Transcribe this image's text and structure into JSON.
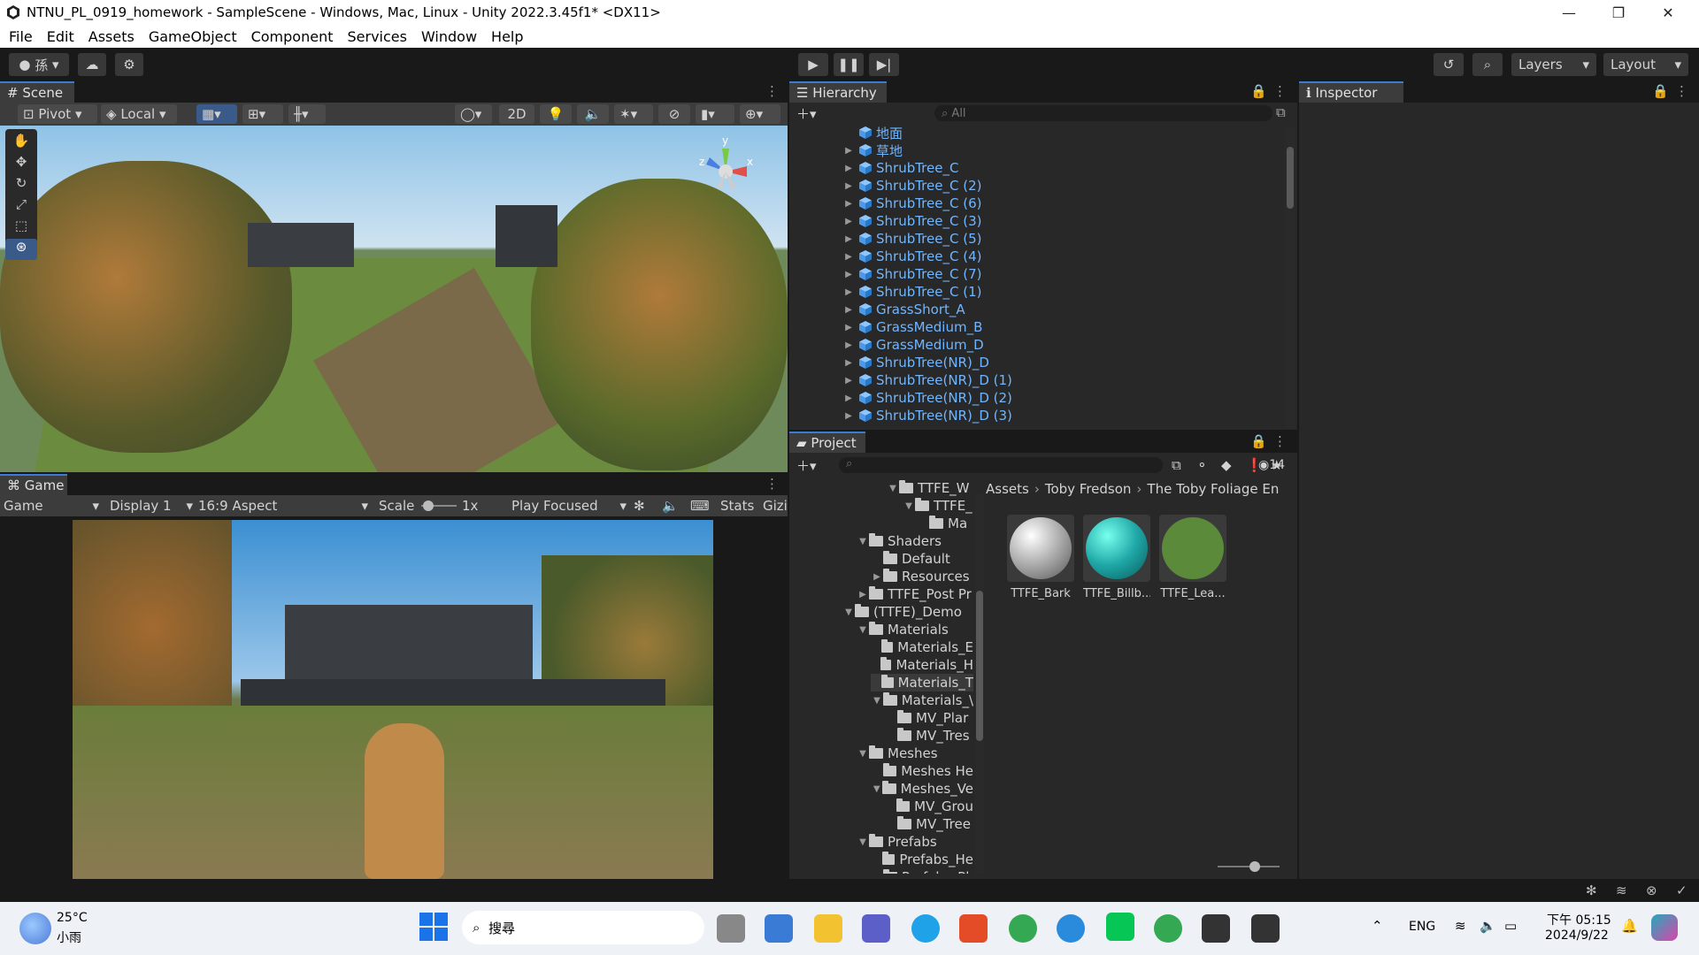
{
  "window": {
    "title": "NTNU_PL_0919_homework - SampleScene - Windows, Mac, Linux - Unity 2022.3.45f1* <DX11>"
  },
  "menu": [
    "File",
    "Edit",
    "Assets",
    "GameObject",
    "Component",
    "Services",
    "Window",
    "Help"
  ],
  "toolbar": {
    "layers": "Layers",
    "layout": "Layout",
    "account_label": "孫"
  },
  "scene": {
    "tab": "Scene",
    "pivot": "Pivot",
    "local": "Local",
    "mode2d": "2D",
    "gizmo_axes": {
      "y": "y",
      "z": "z",
      "x": "x"
    }
  },
  "game": {
    "tab": "Game",
    "view": "Game",
    "display": "Display 1",
    "aspect": "16:9 Aspect",
    "scale_label": "Scale",
    "scale_value": "1x",
    "play_mode": "Play Focused",
    "stats": "Stats",
    "gizmos": "Gizi"
  },
  "hierarchy": {
    "tab": "Hierarchy",
    "search_placeholder": "All",
    "items": [
      {
        "label": "地面",
        "arrow": ""
      },
      {
        "label": "草地",
        "arrow": "▶"
      },
      {
        "label": "ShrubTree_C",
        "arrow": "▶"
      },
      {
        "label": "ShrubTree_C (2)",
        "arrow": "▶"
      },
      {
        "label": "ShrubTree_C (6)",
        "arrow": "▶"
      },
      {
        "label": "ShrubTree_C (3)",
        "arrow": "▶"
      },
      {
        "label": "ShrubTree_C (5)",
        "arrow": "▶"
      },
      {
        "label": "ShrubTree_C (4)",
        "arrow": "▶"
      },
      {
        "label": "ShrubTree_C (7)",
        "arrow": "▶"
      },
      {
        "label": "ShrubTree_C (1)",
        "arrow": "▶"
      },
      {
        "label": "GrassShort_A",
        "arrow": "▶"
      },
      {
        "label": "GrassMedium_B",
        "arrow": "▶"
      },
      {
        "label": "GrassMedium_D",
        "arrow": "▶"
      },
      {
        "label": "ShrubTree(NR)_D",
        "arrow": "▶"
      },
      {
        "label": "ShrubTree(NR)_D (1)",
        "arrow": "▶"
      },
      {
        "label": "ShrubTree(NR)_D (2)",
        "arrow": "▶"
      },
      {
        "label": "ShrubTree(NR)_D (3)",
        "arrow": "▶"
      }
    ]
  },
  "project": {
    "tab": "Project",
    "visible_count": "14",
    "breadcrumb": [
      "Assets",
      "Toby Fredson",
      "The Toby Foliage En"
    ],
    "tree": [
      {
        "label": "TTFE_W",
        "arrow": "▼"
      },
      {
        "label": "TTFE_",
        "arrow": "▼"
      },
      {
        "label": "Ma",
        "arrow": ""
      },
      {
        "label": "Shaders",
        "arrow": "▼"
      },
      {
        "label": "Default",
        "arrow": ""
      },
      {
        "label": "Resources",
        "arrow": "▶"
      },
      {
        "label": "TTFE_Post Pr",
        "arrow": "▶"
      },
      {
        "label": "(TTFE)_Demo",
        "arrow": "▼"
      },
      {
        "label": "Materials",
        "arrow": "▼"
      },
      {
        "label": "Materials_E",
        "arrow": ""
      },
      {
        "label": "Materials_H",
        "arrow": ""
      },
      {
        "label": "Materials_T",
        "arrow": ""
      },
      {
        "label": "Materials_\\",
        "arrow": "▼"
      },
      {
        "label": "MV_Plar",
        "arrow": ""
      },
      {
        "label": "MV_Tres",
        "arrow": ""
      },
      {
        "label": "Meshes",
        "arrow": "▼"
      },
      {
        "label": "Meshes He",
        "arrow": ""
      },
      {
        "label": "Meshes_Ve",
        "arrow": "▼"
      },
      {
        "label": "MV_Grou",
        "arrow": ""
      },
      {
        "label": "MV_Tree",
        "arrow": ""
      },
      {
        "label": "Prefabs",
        "arrow": "▼"
      },
      {
        "label": "Prefabs_He",
        "arrow": ""
      },
      {
        "label": "Prefabs_Pl",
        "arrow": ""
      }
    ],
    "assets": [
      {
        "label": "TTFE_Bark",
        "color": "#c8c8c8"
      },
      {
        "label": "TTFE_Billb...",
        "color": "#1fa7a7"
      },
      {
        "label": "TTFE_Lea...",
        "color": "#5a8a3a"
      }
    ]
  },
  "inspector": {
    "tab": "Inspector"
  },
  "taskbar": {
    "temp": "25°C",
    "weather": "小雨",
    "search": "搜尋",
    "lang": "ENG",
    "time": "下午 05:15",
    "date": "2024/9/22"
  }
}
